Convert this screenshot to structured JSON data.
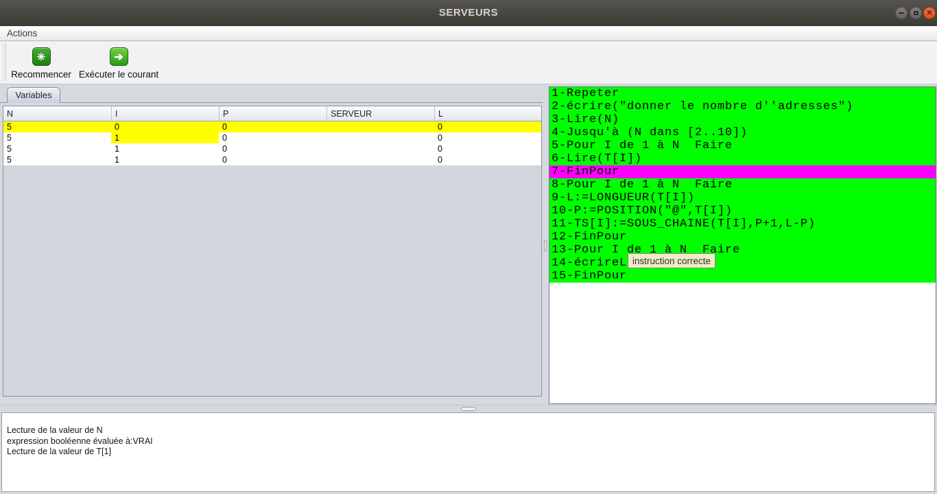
{
  "window": {
    "title": "SERVEURS",
    "control_icons": [
      "minimize-icon",
      "maximize-icon",
      "close-icon"
    ]
  },
  "menu": {
    "actions_label": "Actions"
  },
  "toolbar": {
    "restart_label": "Recommencer",
    "execute_label": "Exécuter le courant",
    "restart_icon": "restart-burst-icon",
    "execute_icon": "run-arrow-icon"
  },
  "variables": {
    "tab_label": "Variables",
    "columns": [
      "N",
      "I",
      "P",
      "SERVEUR",
      "L"
    ],
    "rows": [
      [
        "5",
        "0",
        "0",
        "",
        "0"
      ],
      [
        "5",
        "1",
        "0",
        "",
        "0"
      ],
      [
        "5",
        "1",
        "0",
        "",
        "0"
      ],
      [
        "5",
        "1",
        "0",
        "",
        "0"
      ]
    ],
    "highlights": {
      "rows": [
        0
      ],
      "cells": [
        {
          "row": 1,
          "col": 1
        }
      ]
    }
  },
  "code": {
    "lines": [
      "1-Repeter",
      "2-écrire(\"donner le nombre d''adresses\")",
      "3-Lire(N)",
      "4-Jusqu'à (N dans [2..10])",
      "5-Pour I de 1 à N  Faire",
      "6-Lire(T[I])",
      "7-FinPour",
      "8-Pour I de 1 à N  Faire",
      "9-L:=LONGUEUR(T[I])",
      "10-P:=POSITION(\"@\",T[I])",
      "11-TS[I]:=SOUS_CHAINE(T[I],P+1,L-P)",
      "12-FinPour",
      "13-Pour I de 1 à N  Faire",
      "14-écrireL",
      "15-FinPour"
    ],
    "current_line_number": 7,
    "tooltip": "instruction correcte"
  },
  "log": {
    "lines": [
      "Lecture de la valeur de N",
      "expression booléenne évaluée à:VRAI",
      "Lecture de la valeur de T[1]"
    ]
  },
  "colors": {
    "code_bg": "#00ff00",
    "current_line_bg": "#ff00ff",
    "row_highlight": "#ffff00",
    "close_button": "#e8542c"
  }
}
